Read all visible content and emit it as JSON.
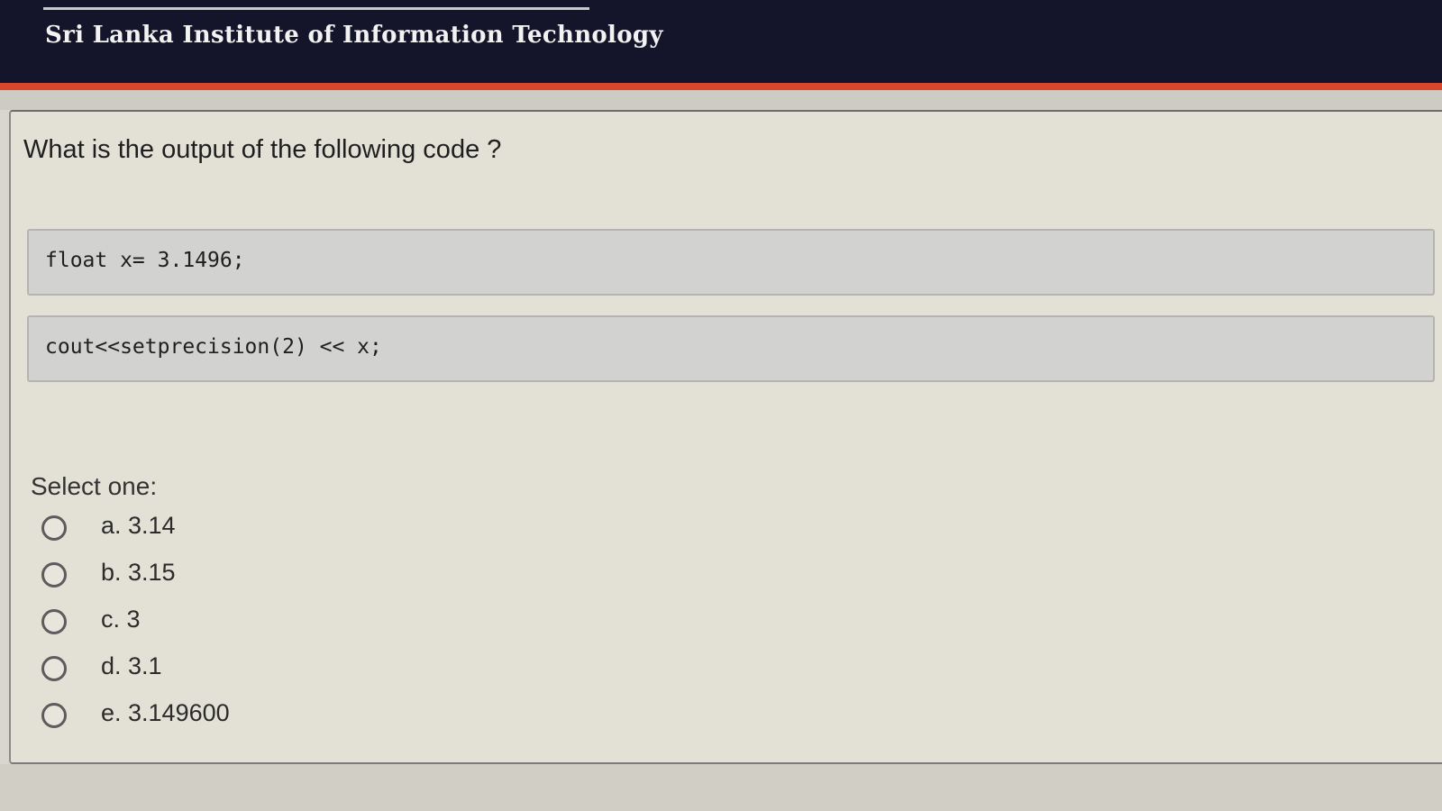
{
  "header": {
    "title": "Sri Lanka Institute of Information Technology"
  },
  "question": {
    "prompt": "What is the output of the following code ?",
    "code_lines": [
      "float x= 3.1496;",
      "cout<<setprecision(2) << x;"
    ],
    "select_label": "Select one:",
    "options": [
      {
        "label": "a. 3.14"
      },
      {
        "label": "b. 3.15"
      },
      {
        "label": "c. 3"
      },
      {
        "label": "d. 3.1"
      },
      {
        "label": "e. 3.149600"
      }
    ]
  },
  "colors": {
    "header_bg": "#14142a",
    "accent": "#d9462b",
    "code_bg": "#d2d3d0"
  }
}
